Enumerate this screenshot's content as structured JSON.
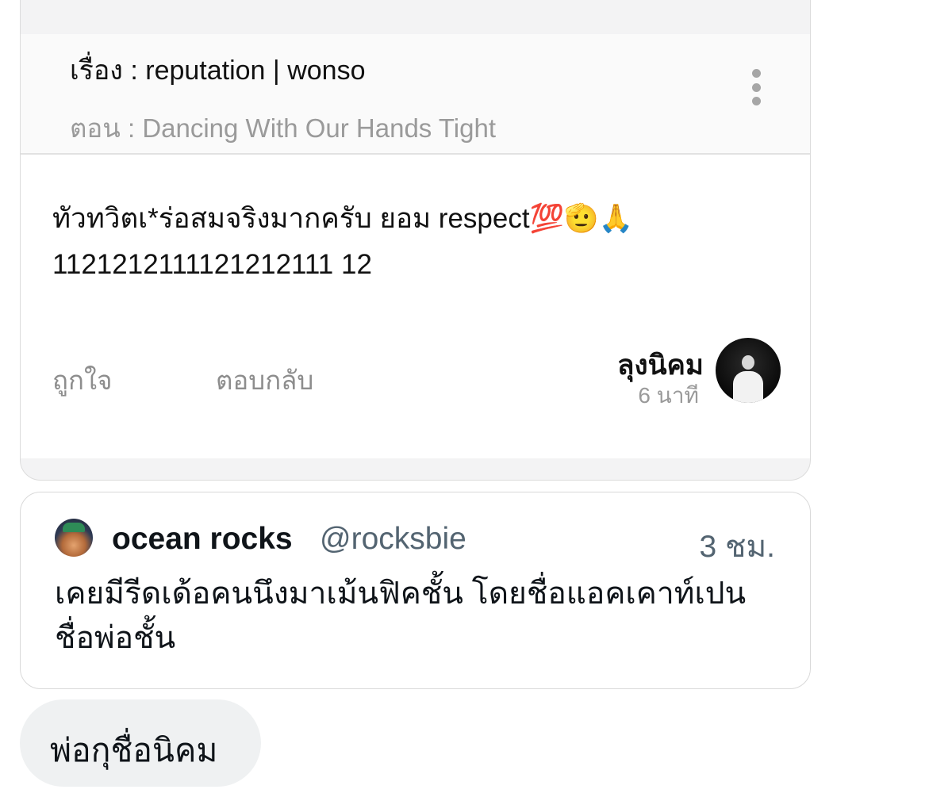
{
  "comment": {
    "story_title": "เรื่อง : reputation | wonso",
    "episode_title": "ตอน : Dancing With Our Hands Tight",
    "text": "ทัวทวิตเ*ร่อสมจริงมากครับ ยอม respect💯🫡🙏 1121212111121212111 12",
    "like_label": "ถูกใจ",
    "reply_label": "ตอบกลับ",
    "author_name": "ลุงนิคม",
    "time": "6 นาที"
  },
  "tweet": {
    "name": "ocean rocks",
    "handle": "@rocksbie",
    "time": "3 ชม.",
    "text": "เคยมีรีดเด้อคนนึงมาเม้นฟิคชั้น โดยชื่อแอคเคาท์เปนชื่อพ่อชั้น"
  },
  "reply": {
    "text": "พ่อกุชื่อนิคม"
  }
}
